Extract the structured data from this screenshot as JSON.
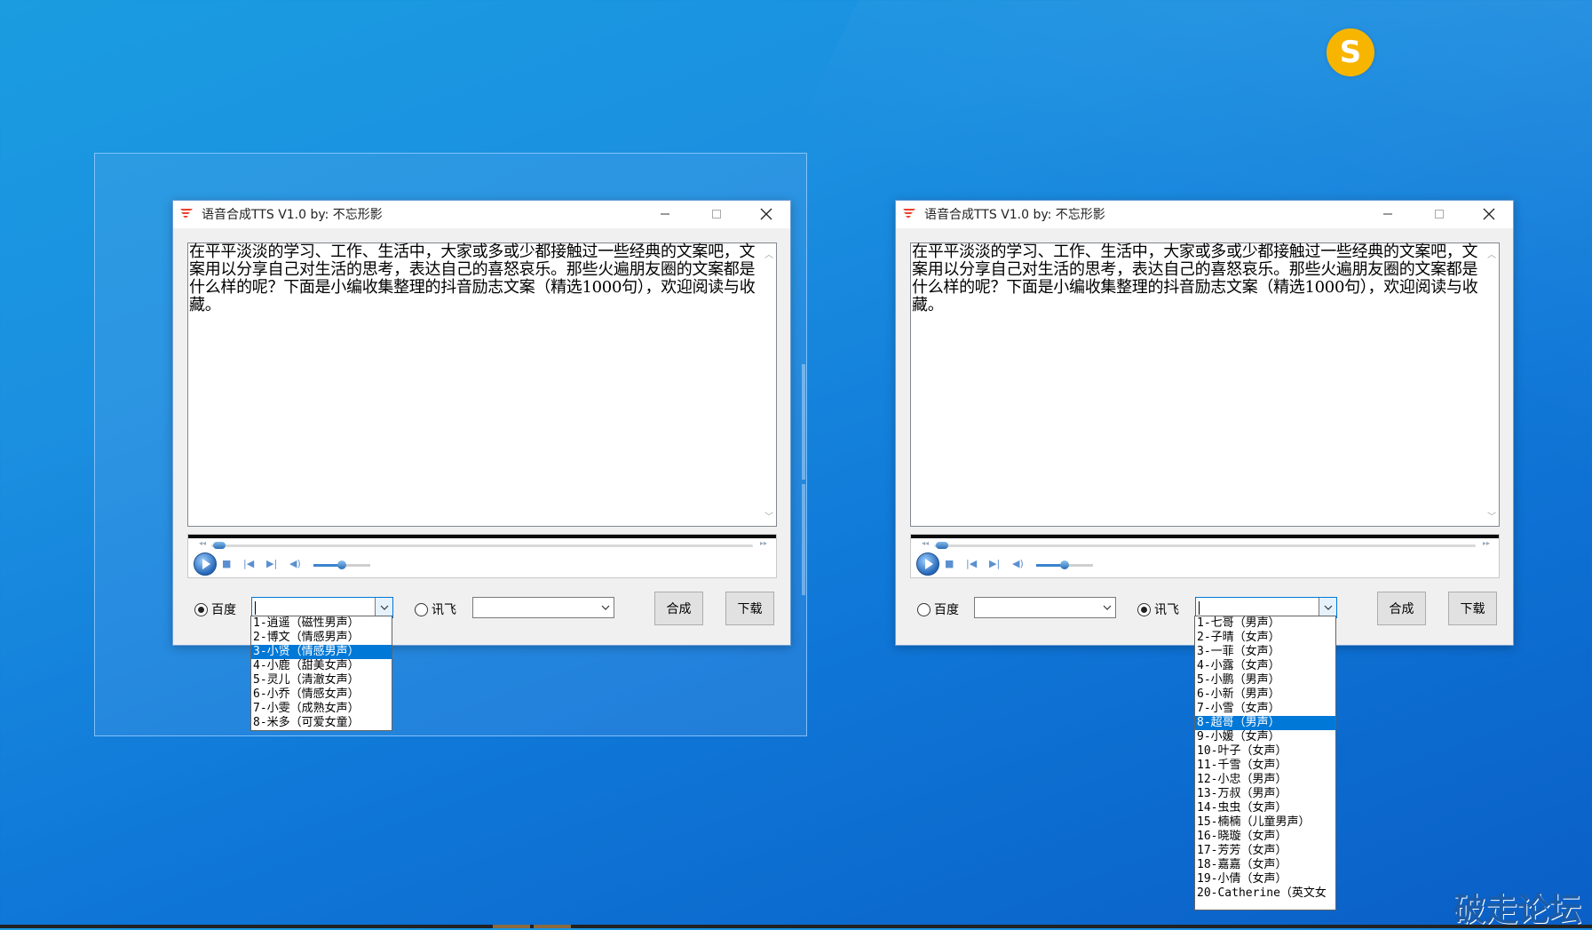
{
  "desktop": {
    "badge_letter": "S",
    "watermark": "破走论坛"
  },
  "windows": [
    {
      "title": "语音合成TTS V1.0 by: 不忘形影",
      "text": "在平平淡淡的学习、工作、生活中，大家或多或少都接触过一些经典的文案吧，文案用以分享自己对生活的思考，表达自己的喜怒哀乐。那些火遍朋友圈的文案都是什么样的呢？下面是小编收集整理的抖音励志文案（精选1000句），欢迎阅读与收藏。",
      "radio_baidu_label": "百度",
      "radio_xunfei_label": "讯飞",
      "radio_selected": "baidu",
      "baidu_value": "",
      "xunfei_value": "",
      "synth_label": "合成",
      "download_label": "下载",
      "dropdown_for": "baidu",
      "dropdown_options": [
        "1-逍遥（磁性男声）",
        "2-博文（情感男声）",
        "3-小贤（情感男声）",
        "4-小鹿（甜美女声）",
        "5-灵儿（清澈女声）",
        "6-小乔（情感女声）",
        "7-小雯（成熟女声）",
        "8-米多（可爱女童）"
      ],
      "dropdown_selected_index": 2
    },
    {
      "title": "语音合成TTS V1.0 by: 不忘形影",
      "text": "在平平淡淡的学习、工作、生活中，大家或多或少都接触过一些经典的文案吧，文案用以分享自己对生活的思考，表达自己的喜怒哀乐。那些火遍朋友圈的文案都是什么样的呢？下面是小编收集整理的抖音励志文案（精选1000句），欢迎阅读与收藏。",
      "radio_baidu_label": "百度",
      "radio_xunfei_label": "讯飞",
      "radio_selected": "xunfei",
      "baidu_value": "",
      "xunfei_value": "",
      "synth_label": "合成",
      "download_label": "下载",
      "dropdown_for": "xunfei",
      "dropdown_options": [
        "1-七哥（男声）",
        "2-子晴（女声）",
        "3-一菲（女声）",
        "4-小露（女声）",
        "5-小鹏（男声）",
        "6-小新（男声）",
        "7-小雪（女声）",
        "8-超哥（男声）",
        "9-小媛（女声）",
        "10-叶子（女声）",
        "11-千雪（女声）",
        "12-小忠（男声）",
        "13-万叔（男声）",
        "14-虫虫（女声）",
        "15-楠楠（儿童男声）",
        "16-晓璇（女声）",
        "17-芳芳（女声）",
        "18-嘉嘉（女声）",
        "19-小倩（女声）",
        "20-Catherine（英文女"
      ],
      "dropdown_selected_index": 7
    }
  ],
  "colors": {
    "selection": "#0078d7",
    "badge": "#f7b500"
  }
}
